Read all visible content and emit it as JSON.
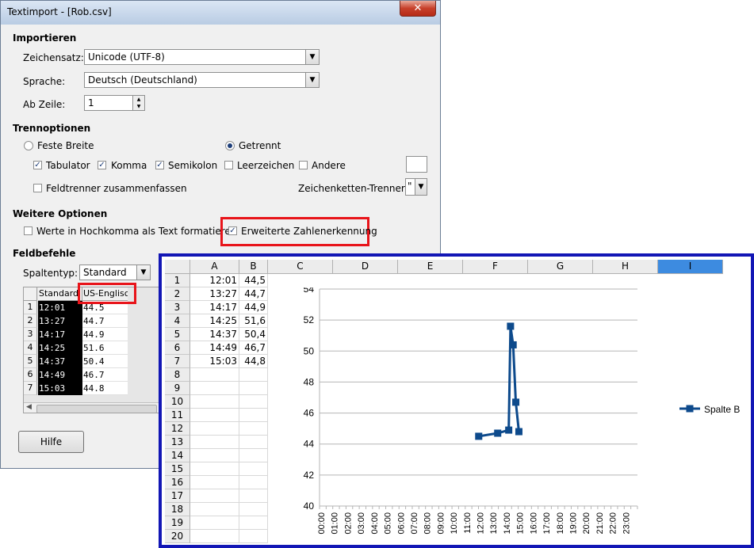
{
  "dialog": {
    "title": "Textimport - [Rob.csv]",
    "close_glyph": "✕",
    "import_section": "Importieren",
    "charset_label": "Zeichensatz:",
    "charset_value": "Unicode (UTF-8)",
    "language_label": "Sprache:",
    "language_value": "Deutsch (Deutschland)",
    "from_row_label": "Ab Zeile:",
    "from_row_value": "1",
    "separator_section": "Trennoptionen",
    "fixed_width": "Feste Breite",
    "separated": "Getrennt",
    "tab": "Tabulator",
    "comma": "Komma",
    "semicolon": "Semikolon",
    "space": "Leerzeichen",
    "other": "Andere",
    "merge_delimiters": "Feldtrenner zusammenfassen",
    "string_delimiter_label": "Zeichenketten-Trenner:",
    "string_delimiter_value": "\"",
    "other_options_section": "Weitere Optionen",
    "quoted_as_text": "Werte in Hochkomma als Text formatieren",
    "detect_special_numbers": "Erweiterte Zahlenerkennung",
    "fields_section": "Feldbefehle",
    "column_type_label": "Spaltentyp:",
    "column_type_value": "Standard",
    "preview_headers": [
      "Standard",
      "US-Englisc"
    ],
    "preview_rows": [
      {
        "n": "1",
        "a": "12:01",
        "b": "44.5"
      },
      {
        "n": "2",
        "a": "13:27",
        "b": "44.7"
      },
      {
        "n": "3",
        "a": "14:17",
        "b": "44.9"
      },
      {
        "n": "4",
        "a": "14:25",
        "b": "51.6"
      },
      {
        "n": "5",
        "a": "14:37",
        "b": "50.4"
      },
      {
        "n": "6",
        "a": "14:49",
        "b": "46.7"
      },
      {
        "n": "7",
        "a": "15:03",
        "b": "44.8"
      }
    ],
    "help_button": "Hilfe"
  },
  "sheet": {
    "columns": [
      "A",
      "B",
      "C",
      "D",
      "E",
      "F",
      "G",
      "H",
      "I"
    ],
    "row_numbers": [
      "1",
      "2",
      "3",
      "4",
      "5",
      "6",
      "7",
      "8",
      "9",
      "10",
      "11",
      "12",
      "13",
      "14",
      "15",
      "16",
      "17",
      "18",
      "19",
      "20"
    ],
    "rows": [
      {
        "a": "12:01",
        "b": "44,5"
      },
      {
        "a": "13:27",
        "b": "44,7"
      },
      {
        "a": "14:17",
        "b": "44,9"
      },
      {
        "a": "14:25",
        "b": "51,6"
      },
      {
        "a": "14:37",
        "b": "50,4"
      },
      {
        "a": "14:49",
        "b": "46,7"
      },
      {
        "a": "15:03",
        "b": "44,8"
      }
    ]
  },
  "colors": {
    "series": "#0d4a8c",
    "highlight_red": "#e8141a",
    "sheet_border": "#1216b5"
  },
  "chart_data": {
    "type": "line",
    "x_labels": [
      "00:00",
      "01:00",
      "02:00",
      "03:00",
      "04:00",
      "05:00",
      "06:00",
      "07:00",
      "08:00",
      "09:00",
      "10:00",
      "11:00",
      "12:00",
      "13:00",
      "14:00",
      "15:00",
      "16:00",
      "17:00",
      "18:00",
      "19:00",
      "20:00",
      "21:00",
      "22:00",
      "23:00"
    ],
    "y_ticks": [
      "40",
      "42",
      "44",
      "46",
      "48",
      "50",
      "52",
      "54"
    ],
    "ylim": [
      40,
      54
    ],
    "xlim_hours": [
      0,
      24
    ],
    "series": [
      {
        "name": "Spalte B",
        "x_hours": [
          12.0167,
          13.45,
          14.2833,
          14.4167,
          14.6167,
          14.8167,
          15.05
        ],
        "values": [
          44.5,
          44.7,
          44.9,
          51.6,
          50.4,
          46.7,
          44.8
        ]
      }
    ],
    "legend": "right",
    "grid": "horizontal"
  }
}
